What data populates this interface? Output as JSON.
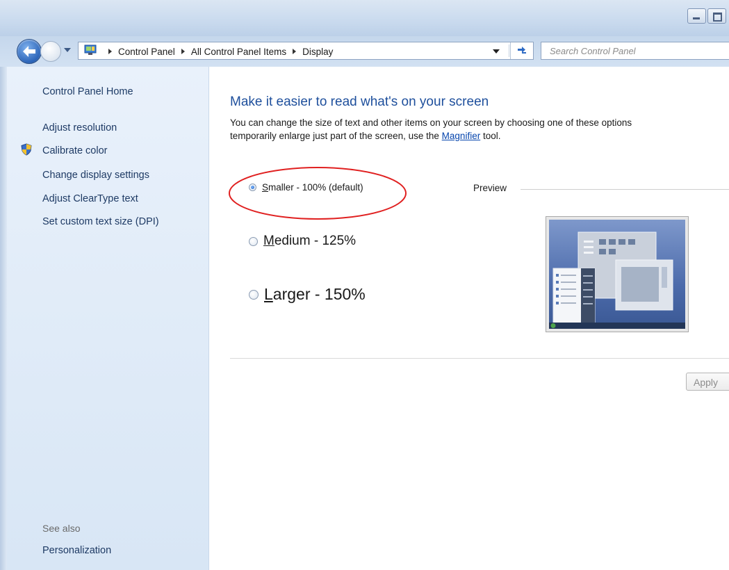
{
  "window": {
    "caption_buttons": [
      "minimize",
      "maximize"
    ]
  },
  "address": {
    "breadcrumbs": [
      "Control Panel",
      "All Control Panel Items",
      "Display"
    ],
    "search_placeholder": "Search Control Panel"
  },
  "sidebar": {
    "home": "Control Panel Home",
    "items": [
      "Adjust resolution",
      "Calibrate color",
      "Change display settings",
      "Adjust ClearType text",
      "Set custom text size (DPI)"
    ],
    "see_also_label": "See also",
    "see_also_items": [
      "Personalization"
    ]
  },
  "main": {
    "heading": "Make it easier to read what's on your screen",
    "description_line1": "You can change the size of text and other items on your screen by choosing one of these options",
    "description_line2_pre": "temporarily enlarge just part of the screen, use the ",
    "magnifier_link": "Magnifier",
    "description_line2_post": " tool.",
    "options": [
      {
        "accel": "S",
        "rest": "maller - 100% (default)",
        "selected": true
      },
      {
        "accel": "M",
        "rest": "edium - 125%",
        "selected": false
      },
      {
        "accel": "L",
        "rest": "arger - 150%",
        "selected": false
      }
    ],
    "preview_label": "Preview",
    "apply_label": "Apply"
  },
  "colors": {
    "heading": "#1e4f9c",
    "link": "#0645ad",
    "highlight_ellipse": "#e02020"
  }
}
